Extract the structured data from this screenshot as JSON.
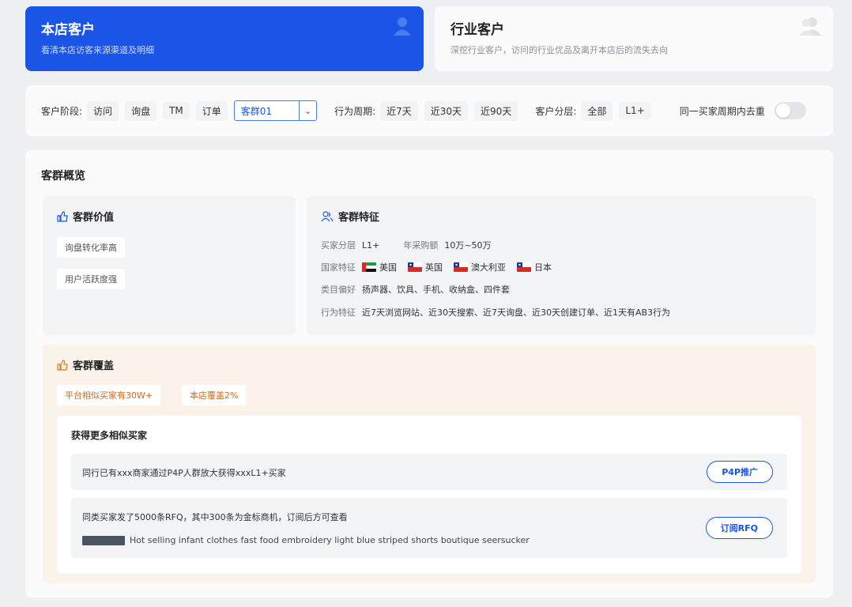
{
  "tabs": {
    "store": {
      "title": "本店客户",
      "subtitle": "看清本店访客来源渠道及明细"
    },
    "industry": {
      "title": "行业客户",
      "subtitle": "深挖行业客户，访问的行业优品及离开本店后的流失去向"
    }
  },
  "filters": {
    "stage_label": "客户阶段:",
    "stage_options": [
      "访问",
      "询盘",
      "TM",
      "订单"
    ],
    "group_select_value": "客群01",
    "period_label": "行为周期:",
    "period_options": [
      "近7天",
      "近30天",
      "近90天"
    ],
    "tier_label": "客户分层:",
    "tier_options": [
      "全部",
      "L1+"
    ],
    "dedupe_label": "同一买家周期内去重"
  },
  "overview": {
    "title": "客群概览",
    "value": {
      "title": "客群价值",
      "tags": [
        "询盘转化率高",
        "用户活跃度强"
      ]
    },
    "feature": {
      "title": "客群特征",
      "tier_key": "买家分层",
      "tier_val": "L1+",
      "purchase_key": "年采购额",
      "purchase_val": "10万~50万",
      "country_key": "国家特征",
      "countries": [
        "美国",
        "英国",
        "澳大利亚",
        "日本"
      ],
      "category_key": "类目偏好",
      "category_val": "扬声器、饮具、手机、收纳盒、四件套",
      "behavior_key": "行为特征",
      "behavior_val": "近7天浏览网站、近30天搜索、近7天询盘、近30天创建订单、近1天有AB3行为"
    },
    "coverage": {
      "title": "客群覆盖",
      "tag_platform": "平台相似买家有30W+",
      "tag_store": "本店覆盖2%",
      "more_title": "获得更多相似买家",
      "row1_text": "同行已有xxx商家通过P4P人群放大获得xxxL1+买家",
      "row1_button": "P4P推广",
      "row2_text": "同类买家发了5000条RFQ，其中300条为金标商机，订阅后方可查看",
      "row2_sub": "Hot selling infant clothes fast food embroidery light blue striped shorts boutique seersucker",
      "row2_button": "订阅RFQ"
    }
  },
  "colors": {
    "primary": "#1a55e8",
    "orange": "#d26a1a",
    "cover_bg": "#fbf3ea"
  }
}
